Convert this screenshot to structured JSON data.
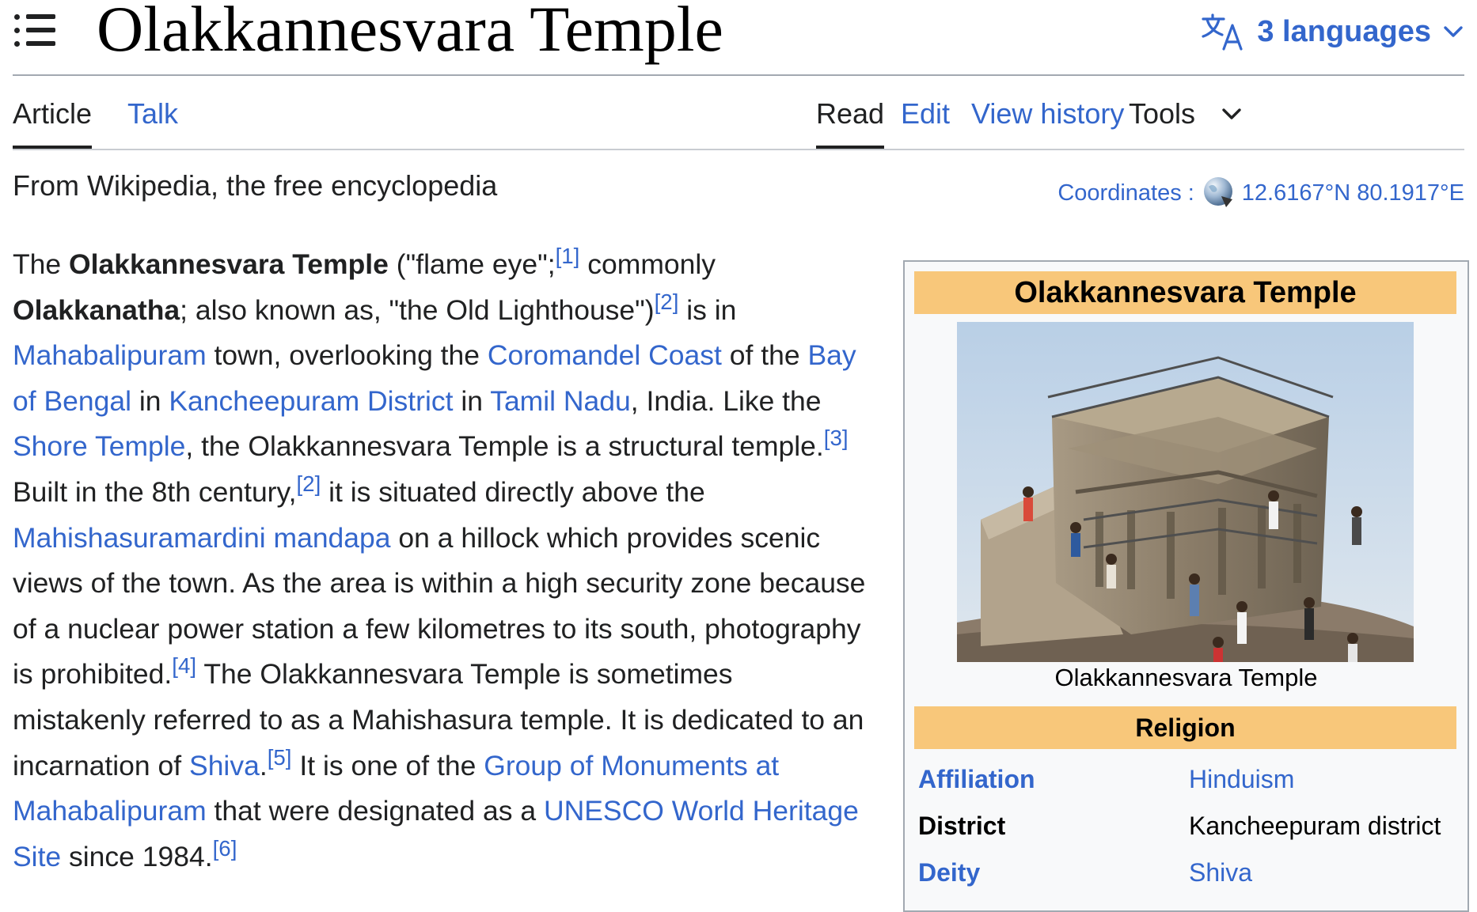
{
  "header": {
    "title": "Olakkannesvara Temple",
    "languages_label": "3 languages"
  },
  "tabs": {
    "left": [
      "Article",
      "Talk"
    ],
    "right": [
      "Read",
      "Edit",
      "View history",
      "Tools"
    ]
  },
  "tagline": "From Wikipedia, the free encyclopedia",
  "coordinates": {
    "label": "Coordinates",
    "value": "12.6167°N 80.1917°E"
  },
  "article": {
    "s1": "The ",
    "bold1": "Olakkannesvara Temple",
    "s2": " (\"flame eye\";",
    "ref1": "[1]",
    "s3": " commonly ",
    "bold2": "Olakkanatha",
    "s4": "; also known as, \"the Old Lighthouse\")",
    "ref2": "[2]",
    "s5": " is in ",
    "link_mahabalipuram": "Mahabalipuram",
    "s6": " town, overlooking the ",
    "link_coromandel": "Coromandel Coast",
    "s7": " of the ",
    "link_bay": "Bay of Bengal",
    "s8": " in ",
    "link_kanchee": "Kancheepuram District",
    "s9": " in ",
    "link_tamil": "Tamil Nadu",
    "s10": ", India. Like the ",
    "link_shore": "Shore Temple",
    "s11": ", the Olakkannesvara Temple is a structural temple.",
    "ref3": "[3]",
    "s12": " Built in the 8th century,",
    "ref4": "[2]",
    "s13": " it is situated directly above the ",
    "link_mandapa": "Mahishasuramardini mandapa",
    "s14": " on a hillock which provides scenic views of the town. As the area is within a high security zone because of a nuclear power station a few kilometres to its south, photography is prohibited.",
    "ref5": "[4]",
    "s15": " The Olakkannesvara Temple is sometimes mistakenly referred to as a Mahishasura temple. It is dedicated to an incarnation of ",
    "link_shiva": "Shiva",
    "s16": ".",
    "ref6": "[5]",
    "s17": " It is one of the ",
    "link_group": "Group of Monuments at Mahabalipuram",
    "s18": " that were designated as a ",
    "link_unesco": "UNESCO World Heritage Site",
    "s19": " since 1984.",
    "ref7": "[6]"
  },
  "infobox": {
    "title": "Olakkannesvara Temple",
    "caption": "Olakkannesvara Temple",
    "section": "Religion",
    "rows": [
      {
        "label": "Affiliation",
        "value": "Hinduism"
      },
      {
        "label": "District",
        "value": "Kancheepuram district"
      },
      {
        "label": "Deity",
        "value": "Shiva"
      }
    ]
  },
  "colors": {
    "link": "#3366cc",
    "infobox_header": "#f8c77a",
    "text": "#202122"
  },
  "icons": [
    "menu-icon",
    "language-icon",
    "chevron-down-icon",
    "globe-icon"
  ]
}
